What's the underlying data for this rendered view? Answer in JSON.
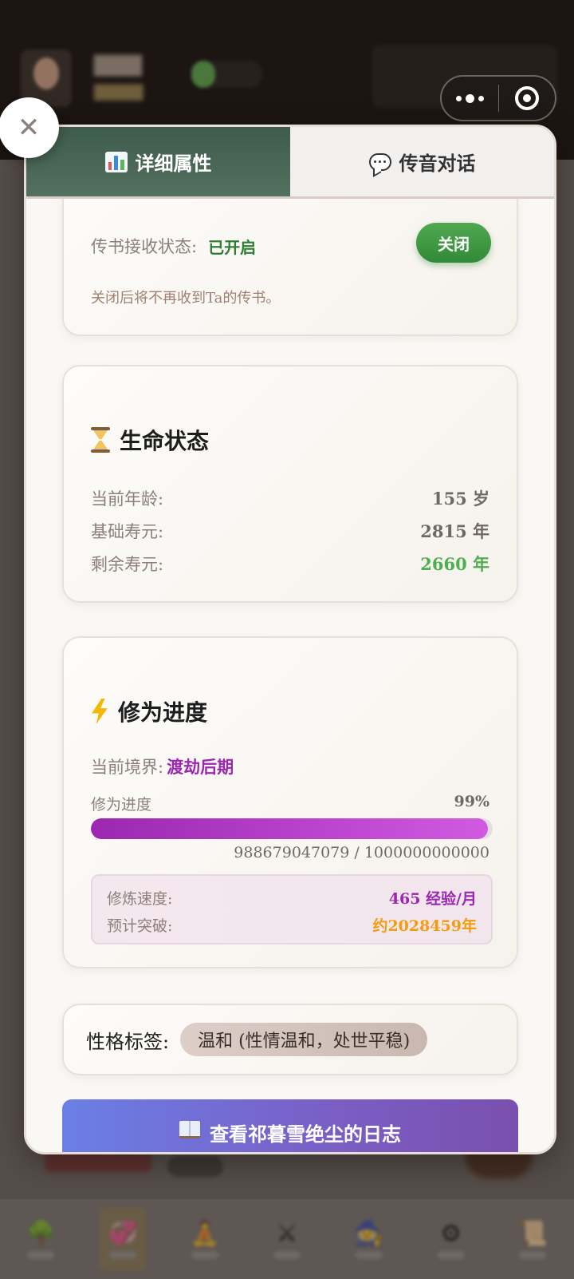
{
  "tabs": [
    {
      "label": "详细属性",
      "icon": "bar-chart-icon",
      "active": true
    },
    {
      "label": "传音对话",
      "icon": "speech-bubble-icon",
      "active": false
    }
  ],
  "inbox": {
    "label": "传书接收状态:",
    "status": "已开启",
    "toggle_label": "关闭",
    "hint": "关闭后将不再收到Ta的传书。"
  },
  "life": {
    "title": "生命状态",
    "rows": [
      {
        "label": "当前年龄:",
        "value": "155 岁"
      },
      {
        "label": "基础寿元:",
        "value": "2815 年"
      },
      {
        "label": "剩余寿元:",
        "value": "2660 年"
      }
    ]
  },
  "cultivation": {
    "title": "修为进度",
    "realm_label": "当前境界:",
    "realm_value": "渡劫后期",
    "progress_label": "修为进度",
    "progress_percent_text": "99%",
    "progress_fraction": 0.9887,
    "progress_numbers": "988679047079 / 1000000000000",
    "speed_label": "修炼速度:",
    "speed_value": "465 经验/月",
    "eta_label": "预计突破:",
    "eta_value": "约2028459年"
  },
  "personality": {
    "label": "性格标签:",
    "tag": "温和 (性情温和，处世平稳)"
  },
  "log_button": "查看祁暮雪绝尘的日志",
  "colors": {
    "active_tab": "#3e5c4c",
    "status_green": "#2e7d32",
    "realm_purple": "#9c27b0",
    "eta_orange": "#f39c12",
    "remaining_green": "#4caf50"
  }
}
